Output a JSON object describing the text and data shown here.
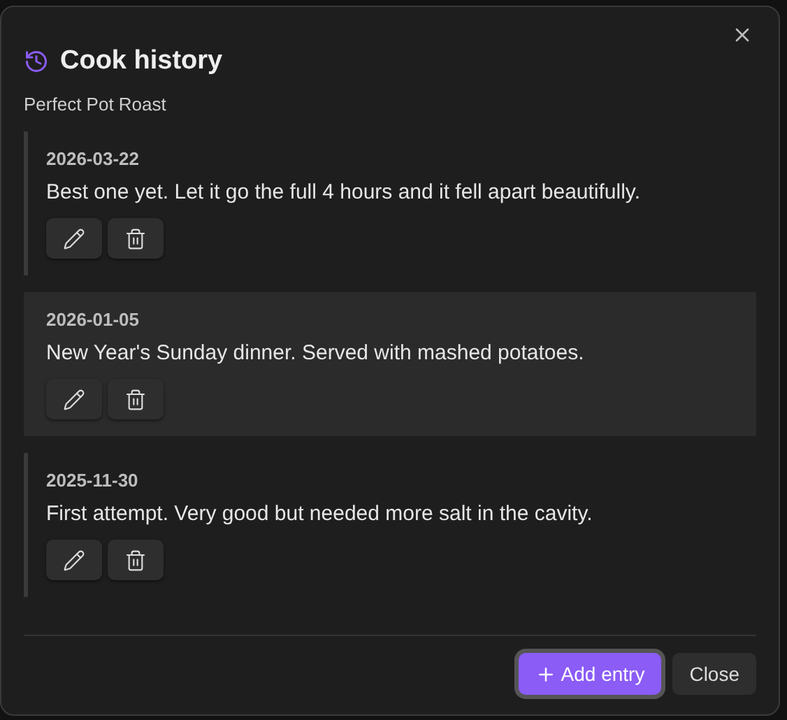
{
  "dialog": {
    "title": "Cook history",
    "subtitle": "Perfect Pot Roast"
  },
  "entries": [
    {
      "date": "2026-03-22",
      "note": "Best one yet. Let it go the full 4 hours and it fell apart beautifully.",
      "highlighted": false
    },
    {
      "date": "2026-01-05",
      "note": "New Year's Sunday dinner. Served with mashed potatoes.",
      "highlighted": true
    },
    {
      "date": "2025-11-30",
      "note": "First attempt. Very good but needed more salt in the cavity.",
      "highlighted": false
    }
  ],
  "buttons": [
    {
      "label": "Add entry",
      "kind": "primary"
    },
    {
      "label": "Close",
      "kind": "secondary"
    }
  ]
}
